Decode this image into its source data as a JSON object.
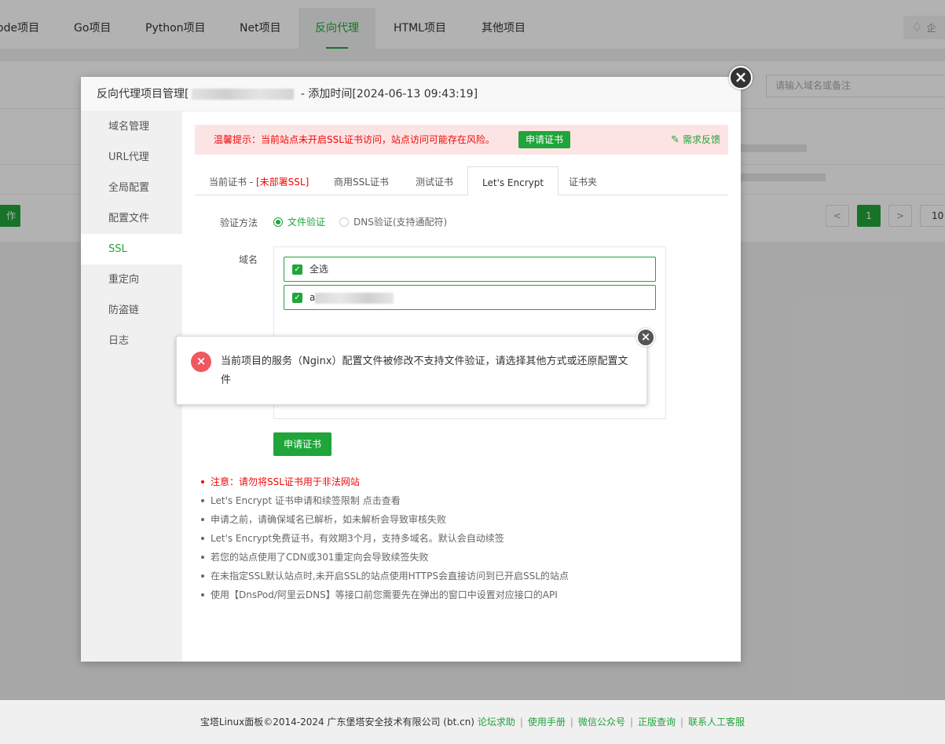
{
  "top_nav": {
    "tabs": [
      {
        "label": "ode项目"
      },
      {
        "label": "Go项目"
      },
      {
        "label": "Python项目"
      },
      {
        "label": "Net项目"
      },
      {
        "label": "反向代理"
      },
      {
        "label": "HTML项目"
      },
      {
        "label": "其他项目"
      }
    ],
    "active_tab": "反向代理",
    "right_badge": "企"
  },
  "background": {
    "search_placeholder": "请输入域名或备注",
    "action_button": "作",
    "pagination": {
      "prev": "<",
      "current": "1",
      "next": ">",
      "page_size": "10"
    }
  },
  "modal": {
    "title_prefix": "反向代理项目管理[",
    "title_suffix": " - 添加时间[2024-06-13 09:43:19]",
    "sidebar": [
      {
        "label": "域名管理"
      },
      {
        "label": "URL代理"
      },
      {
        "label": "全局配置"
      },
      {
        "label": "配置文件"
      },
      {
        "label": "SSL"
      },
      {
        "label": "重定向"
      },
      {
        "label": "防盗链"
      },
      {
        "label": "日志"
      }
    ],
    "active_sidebar": "SSL",
    "alert": {
      "text": "温馨提示：当前站点未开启SSL证书访问，站点访问可能存在风险。",
      "button": "申请证书",
      "feedback": "需求反馈"
    },
    "ssl_tabs": {
      "current_prefix": "当前证书 - ",
      "current_status": "[未部署SSL]",
      "commercial": "商用SSL证书",
      "test": "测试证书",
      "letsencrypt": "Let's Encrypt",
      "folder": "证书夹"
    },
    "verify": {
      "label": "验证方法",
      "file_option": "文件验证",
      "dns_option": "DNS验证(支持通配符)"
    },
    "domain": {
      "label": "域名",
      "select_all": "全选",
      "item_prefix": "a"
    },
    "apply_button": "申请证书",
    "notes": [
      "注意：请勿将SSL证书用于非法网站",
      "Let's Encrypt 证书申请和续签限制 点击查看",
      "申请之前，请确保域名已解析，如未解析会导致审核失败",
      "Let's Encrypt免费证书，有效期3个月，支持多域名。默认会自动续签",
      "若您的站点使用了CDN或301重定向会导致续签失败",
      "在未指定SSL默认站点时,未开启SSL的站点使用HTTPS会直接访问到已开启SSL的站点",
      "使用【DnsPod/阿里云DNS】等接口前您需要先在弹出的窗口中设置对应接口的API"
    ]
  },
  "toast": {
    "message": "当前项目的服务（Nginx）配置文件被修改不支持文件验证，请选择其他方式或还原配置文件"
  },
  "footer": {
    "copyright": "宝塔Linux面板©2014-2024 广东堡塔安全技术有限公司 (bt.cn)",
    "links": [
      "论坛求助",
      "使用手册",
      "微信公众号",
      "正版查询",
      "联系人工客服"
    ]
  },
  "colors": {
    "accent": "#20a53a",
    "danger": "#ef0808",
    "alert_bg": "#fde4e4"
  }
}
